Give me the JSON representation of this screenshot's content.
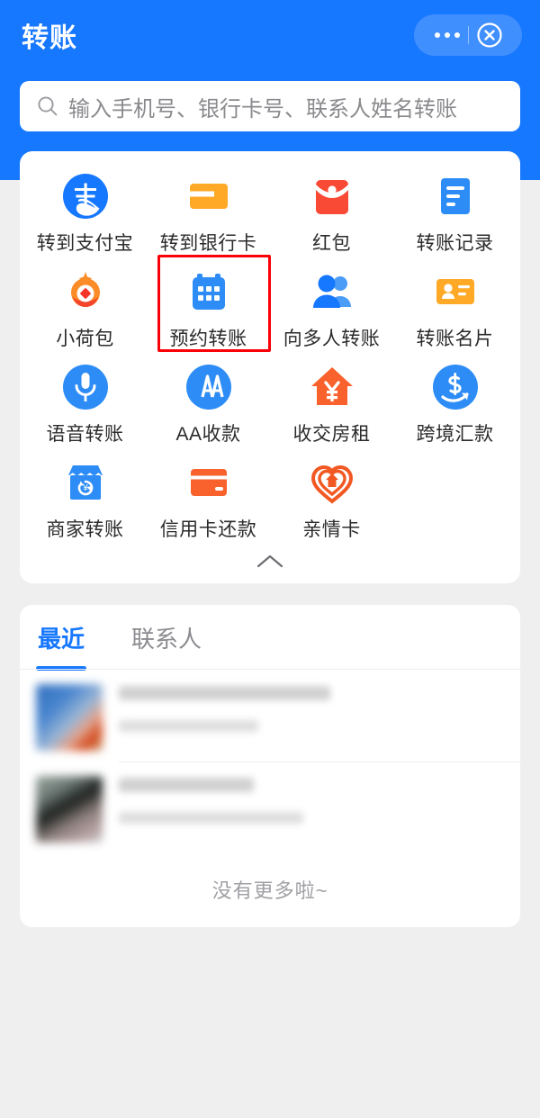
{
  "header": {
    "title": "转账",
    "more_icon": "ellipsis-icon",
    "close_icon": "close-circle-icon",
    "background_color": "#1677FF"
  },
  "search": {
    "icon": "search-icon",
    "placeholder": "输入手机号、银行卡号、联系人姓名转账",
    "value": ""
  },
  "grid": {
    "collapse_icon": "chevron-up-icon",
    "highlighted_item": "预约转账",
    "highlight_color": "#FB0007",
    "items": [
      {
        "label": "转到支付宝",
        "icon": "alipay-logo-icon",
        "color": "#1677FF"
      },
      {
        "label": "转到银行卡",
        "icon": "bank-card-arrow-icon",
        "color": "#FFA927"
      },
      {
        "label": "红包",
        "icon": "red-packet-icon",
        "color": "#F94A36"
      },
      {
        "label": "转账记录",
        "icon": "transfer-record-icon",
        "color": "#2D8CF5"
      },
      {
        "label": "小荷包",
        "icon": "small-pocket-icon",
        "color": "#FB8C28"
      },
      {
        "label": "预约转账",
        "icon": "calendar-icon",
        "color": "#2D8CF5"
      },
      {
        "label": "向多人转账",
        "icon": "multi-people-icon",
        "color": "#2D8CF5"
      },
      {
        "label": "转账名片",
        "icon": "contact-card-icon",
        "color": "#FFA927"
      },
      {
        "label": "语音转账",
        "icon": "microphone-icon",
        "color": "#2D8CF5"
      },
      {
        "label": "AA收款",
        "icon": "aa-collect-icon",
        "color": "#2D8CF5"
      },
      {
        "label": "收交房租",
        "icon": "house-rent-yuan-icon",
        "color": "#F9622C"
      },
      {
        "label": "跨境汇款",
        "icon": "cross-border-dollar-icon",
        "color": "#2D8CF5"
      },
      {
        "label": "商家转账",
        "icon": "merchant-shop-icon",
        "color": "#2D8CF5"
      },
      {
        "label": "信用卡还款",
        "icon": "credit-card-icon",
        "color": "#F9622C"
      },
      {
        "label": "亲情卡",
        "icon": "family-heart-icon",
        "color": "#F25822"
      }
    ]
  },
  "list": {
    "tabs": [
      {
        "label": "最近",
        "active": true
      },
      {
        "label": "联系人",
        "active": false
      }
    ],
    "rows": [
      {
        "name": "",
        "subtitle": "",
        "avatar": "blurred-avatar"
      },
      {
        "name": "",
        "subtitle": "",
        "avatar": "blurred-avatar"
      }
    ],
    "footer_text": "没有更多啦~"
  }
}
